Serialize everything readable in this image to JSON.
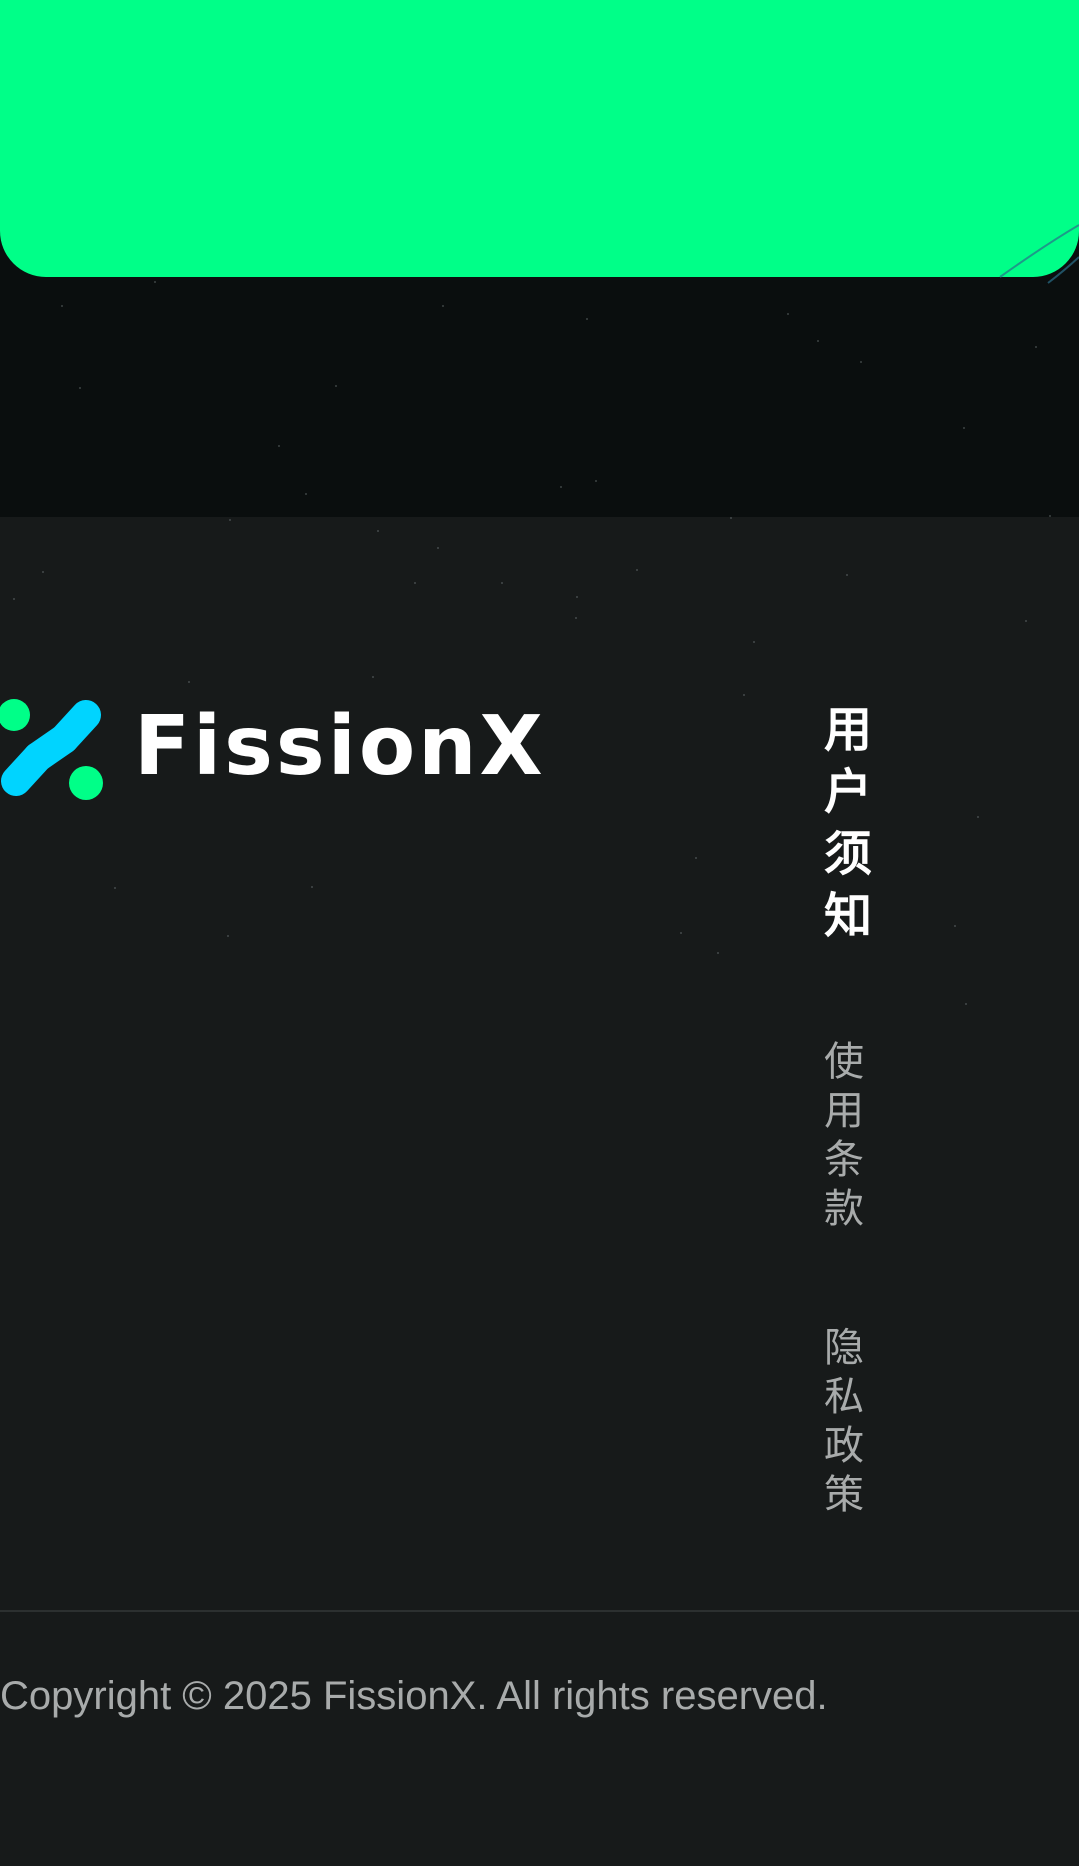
{
  "brand": {
    "name": "FissionX",
    "logo_icon": "fissionx-molecule-icon",
    "accent_green": "#00ff88",
    "accent_cyan": "#00d4ff"
  },
  "cta_banner": {
    "color": "#00ff88"
  },
  "footer": {
    "background": "#171a1a",
    "links_heading": "用户须知",
    "links": [
      {
        "label": "使用条款"
      },
      {
        "label": "隐私政策"
      }
    ],
    "copyright": "Copyright © 2025 FissionX. All rights reserved."
  }
}
